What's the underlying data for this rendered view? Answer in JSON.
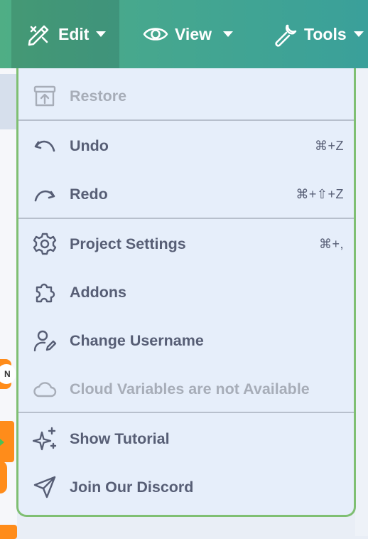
{
  "menubar": {
    "edit_label": "Edit",
    "view_label": "View",
    "tools_label": "Tools"
  },
  "background": {
    "block_letter": "N"
  },
  "dropdown": {
    "restore": {
      "label": "Restore",
      "icon": "restore-icon",
      "disabled": true
    },
    "undo": {
      "label": "Undo",
      "shortcut": "⌘+Z",
      "icon": "undo-icon"
    },
    "redo": {
      "label": "Redo",
      "shortcut": "⌘+⇧+Z",
      "icon": "redo-icon"
    },
    "project_settings": {
      "label": "Project Settings",
      "shortcut": "⌘+,",
      "icon": "gear-icon"
    },
    "addons": {
      "label": "Addons",
      "icon": "puzzle-icon"
    },
    "change_username": {
      "label": "Change Username",
      "icon": "user-edit-icon"
    },
    "cloud": {
      "label": "Cloud Variables are not Available",
      "icon": "cloud-icon",
      "disabled": true
    },
    "tutorial": {
      "label": "Show Tutorial",
      "icon": "sparkles-icon"
    },
    "discord": {
      "label": "Join Our Discord",
      "icon": "send-icon"
    }
  },
  "colors": {
    "menubar_start": "#4fae85",
    "menubar_end": "#3aa09a",
    "dropdown_bg": "#e6eefa",
    "dropdown_border": "#7fbf72",
    "text": "#575e75",
    "disabled_text": "#a7adb8"
  }
}
